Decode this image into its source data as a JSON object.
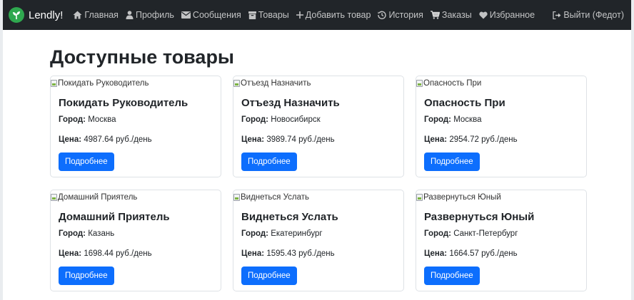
{
  "navbar": {
    "brand": "Lendly!",
    "links": [
      {
        "label": "Главная",
        "icon": "home-icon"
      },
      {
        "label": "Профиль",
        "icon": "user-icon"
      },
      {
        "label": "Сообщения",
        "icon": "envelope-icon"
      },
      {
        "label": "Товары",
        "icon": "box-icon"
      },
      {
        "label": "Добавить товар",
        "icon": "plus-icon"
      },
      {
        "label": "История",
        "icon": "history-icon"
      },
      {
        "label": "Заказы",
        "icon": "cart-icon"
      },
      {
        "label": "Избранное",
        "icon": "heart-icon"
      }
    ],
    "logout": "Выйти (Федот)"
  },
  "main": {
    "title": "Доступные товары",
    "city_label": "Город:",
    "price_label": "Цена:",
    "button_label": "Подробнее",
    "products": [
      {
        "name": "Покидать Руководитель",
        "city": "Москва",
        "price": "4987.64 руб./день"
      },
      {
        "name": "Отъезд Назначить",
        "city": "Новосибирск",
        "price": "3989.74 руб./день"
      },
      {
        "name": "Опасность При",
        "city": "Москва",
        "price": "2954.72 руб./день"
      },
      {
        "name": "Домашний Приятель",
        "city": "Казань",
        "price": "1698.44 руб./день"
      },
      {
        "name": "Виднеться Услать",
        "city": "Екатеринбург",
        "price": "1595.43 руб./день"
      },
      {
        "name": "Развернуться Юный",
        "city": "Санкт-Петербург",
        "price": "1664.57 руб./день"
      }
    ]
  },
  "colors": {
    "navbar_bg": "#212529",
    "primary": "#0d6efd",
    "brand_logo": "#2fa84f"
  }
}
